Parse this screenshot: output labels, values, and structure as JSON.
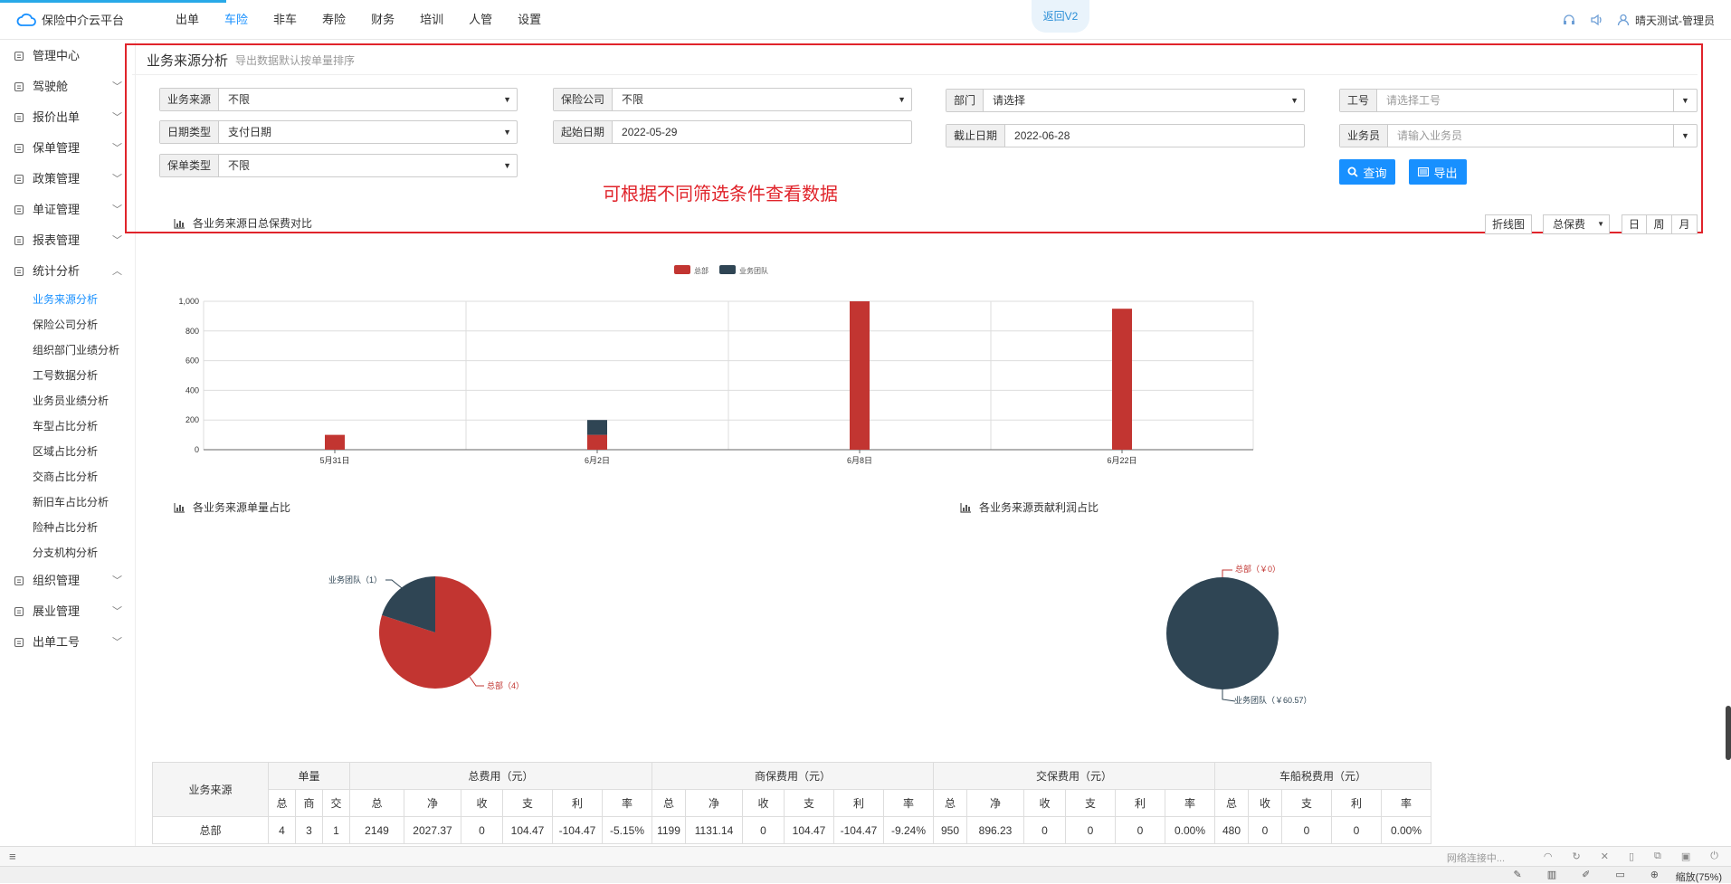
{
  "app": {
    "title": "保险中介云平台",
    "return_label": "返回V2",
    "user": "晴天测试-管理员"
  },
  "topnav": [
    {
      "label": "出单",
      "active": false
    },
    {
      "label": "车险",
      "active": true
    },
    {
      "label": "非车",
      "active": false
    },
    {
      "label": "寿险",
      "active": false
    },
    {
      "label": "财务",
      "active": false
    },
    {
      "label": "培训",
      "active": false
    },
    {
      "label": "人管",
      "active": false
    },
    {
      "label": "设置",
      "active": false
    }
  ],
  "sidebar": {
    "items": [
      {
        "label": "管理中心",
        "icon": "home-icon"
      },
      {
        "label": "驾驶舱",
        "icon": "dashboard-icon"
      },
      {
        "label": "报价出单",
        "icon": "quote-icon"
      },
      {
        "label": "保单管理",
        "icon": "policy-icon"
      },
      {
        "label": "政策管理",
        "icon": "rule-icon"
      },
      {
        "label": "单证管理",
        "icon": "doc-icon"
      },
      {
        "label": "报表管理",
        "icon": "report-icon"
      },
      {
        "label": "统计分析",
        "icon": "stats-icon"
      }
    ],
    "sub_items": [
      "业务来源分析",
      "保险公司分析",
      "组织部门业绩分析",
      "工号数据分析",
      "业务员业绩分析",
      "车型占比分析",
      "区域占比分析",
      "交商占比分析",
      "新旧车占比分析",
      "险种占比分析",
      "分支机构分析"
    ],
    "bottom_items": [
      {
        "label": "组织管理",
        "icon": "org-icon"
      },
      {
        "label": "展业管理",
        "icon": "promote-icon"
      },
      {
        "label": "出单工号",
        "icon": "account-icon"
      }
    ]
  },
  "panel": {
    "title": "业务来源分析",
    "subtitle": "导出数据默认按单量排序"
  },
  "filters": {
    "source": {
      "label": "业务来源",
      "value": "不限"
    },
    "insurer": {
      "label": "保险公司",
      "value": "不限"
    },
    "dept": {
      "label": "部门",
      "value": "请选择"
    },
    "job_no": {
      "label": "工号",
      "placeholder": "请选择工号"
    },
    "date_type": {
      "label": "日期类型",
      "value": "支付日期"
    },
    "start_date": {
      "label": "起始日期",
      "value": "2022-05-29"
    },
    "end_date": {
      "label": "截止日期",
      "value": "2022-06-28"
    },
    "salesman": {
      "label": "业务员",
      "placeholder": "请输入业务员"
    },
    "policy_type": {
      "label": "保单类型",
      "value": "不限"
    }
  },
  "buttons": {
    "query": "查询",
    "export": "导出"
  },
  "note": "可根据不同筛选条件查看数据",
  "sections": {
    "daily": "各业务来源日总保费对比",
    "count_ratio": "各业务来源单量占比",
    "profit_ratio": "各业务来源贡献利润占比"
  },
  "chart_tools": {
    "line": "折线图",
    "metric": "总保费",
    "day": "日",
    "week": "周",
    "month": "月"
  },
  "colors": {
    "hq": "#c23531",
    "team": "#2f4554",
    "accent": "#1890ff",
    "highlight": "#e0242b"
  },
  "chart_data": [
    {
      "type": "bar",
      "stacked": true,
      "categories": [
        "5月31日",
        "6月2日",
        "6月8日",
        "6月22日"
      ],
      "series": [
        {
          "name": "总部",
          "values": [
            100,
            100,
            1000,
            950
          ]
        },
        {
          "name": "业务团队",
          "values": [
            0,
            100,
            0,
            0
          ]
        }
      ],
      "ylim": [
        0,
        1000
      ],
      "yticks": [
        "0",
        "200",
        "400",
        "600",
        "800",
        "1,000"
      ],
      "legend": "top-center",
      "grid": true
    },
    {
      "type": "pie",
      "slices": [
        {
          "name": "总部",
          "value": 4,
          "label": "总部（4）"
        },
        {
          "name": "业务团队",
          "value": 1,
          "label": "业务团队（1）"
        }
      ]
    },
    {
      "type": "pie",
      "slices": [
        {
          "name": "总部",
          "value": 0,
          "label": "总部（￥0）"
        },
        {
          "name": "业务团队",
          "value": 60.57,
          "label": "业务团队（￥60.57）"
        }
      ]
    }
  ],
  "table": {
    "group_headers": [
      "业务来源",
      "单量",
      "总费用（元）",
      "商保费用（元）",
      "交保费用（元）",
      "车船税费用（元）"
    ],
    "sub_headers": [
      "总",
      "商",
      "交",
      "总",
      "净",
      "收",
      "支",
      "利",
      "率",
      "总",
      "净",
      "收",
      "支",
      "利",
      "率",
      "总",
      "净",
      "收",
      "支",
      "利",
      "率",
      "总",
      "收",
      "支",
      "利",
      "率"
    ],
    "rows": [
      [
        "总部",
        "4",
        "3",
        "1",
        "2149",
        "2027.37",
        "0",
        "104.47",
        "-104.47",
        "-5.15%",
        "1199",
        "1131.14",
        "0",
        "104.47",
        "-104.47",
        "-9.24%",
        "950",
        "896.23",
        "0",
        "0",
        "0",
        "0.00%",
        "480",
        "0",
        "0",
        "0",
        "0.00%"
      ]
    ]
  },
  "status": {
    "network": "网络连接中...",
    "zoom": "缩放(75%)"
  }
}
